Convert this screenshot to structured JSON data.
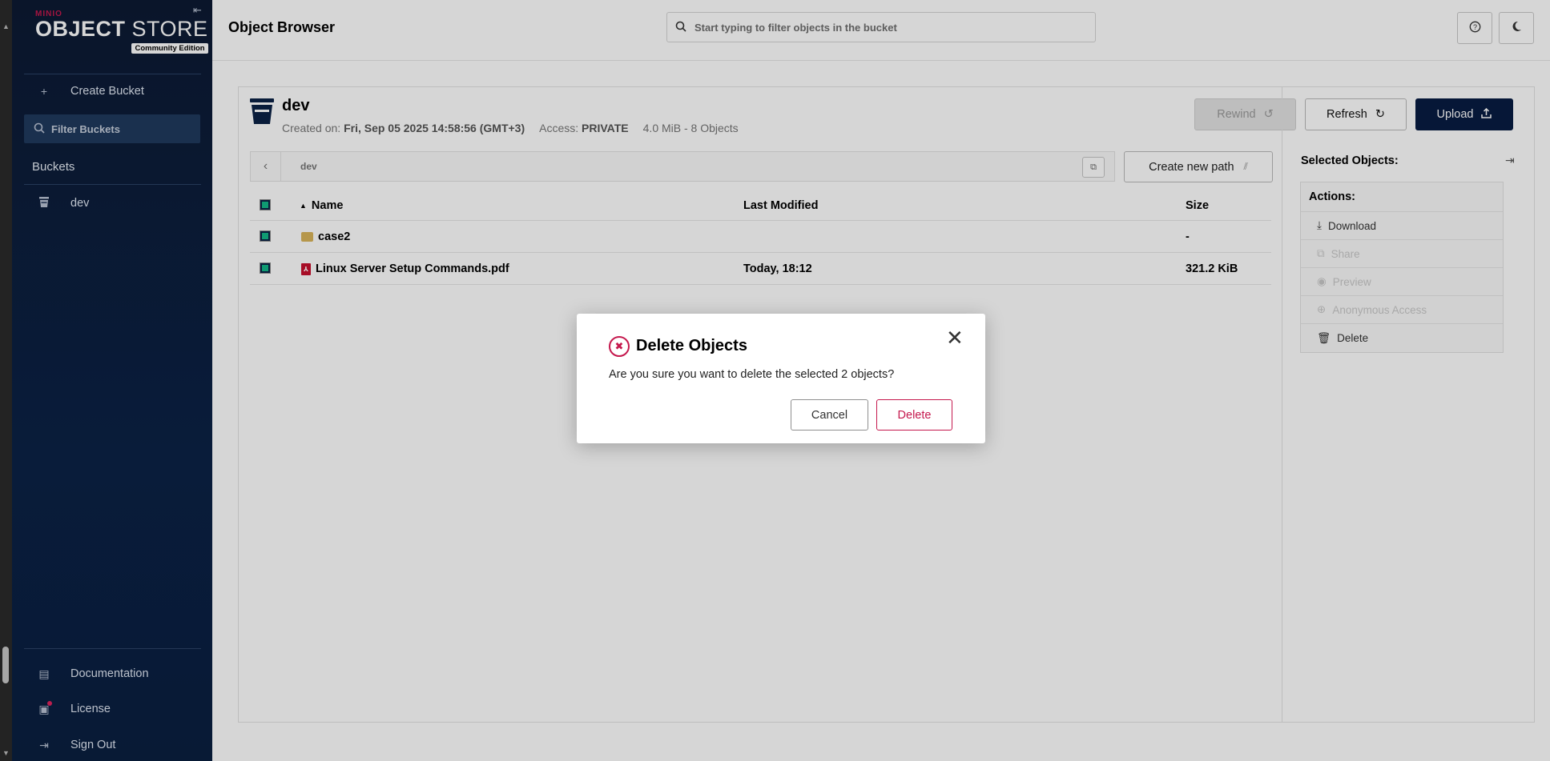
{
  "sidebar": {
    "brand": "MINIO",
    "product_prefix": "OBJECT",
    "product_suffix": " STORE",
    "edition": "Community Edition",
    "create_bucket": "Create Bucket",
    "filter_placeholder": "Filter Buckets",
    "buckets_heading": "Buckets",
    "buckets": [
      {
        "name": "dev"
      }
    ],
    "bottom_items": [
      {
        "label": "Documentation",
        "icon": "documentation-icon"
      },
      {
        "label": "License",
        "icon": "license-icon"
      },
      {
        "label": "Sign Out",
        "icon": "sign-out-icon"
      }
    ]
  },
  "header": {
    "title": "Object Browser",
    "search_placeholder": "Start typing to filter objects in the bucket"
  },
  "bucket": {
    "name": "dev",
    "created_label": "Created on: ",
    "created_value": "Fri, Sep 05 2025 14:58:56 (GMT+3)",
    "access_label": "Access: ",
    "access_value": "PRIVATE",
    "usage": "4.0 MiB - 8 Objects",
    "rewind_label": "Rewind",
    "refresh_label": "Refresh",
    "upload_label": "Upload"
  },
  "breadcrumb": {
    "path": "dev",
    "create_path_label": "Create new path"
  },
  "table": {
    "columns": [
      "Name",
      "Last Modified",
      "Size"
    ],
    "rows": [
      {
        "name": "case2",
        "type": "folder",
        "modified": "",
        "size": "-"
      },
      {
        "name": "Linux Server Setup Commands.pdf",
        "type": "pdf",
        "modified": "Today, 18:12",
        "size": "321.2 KiB"
      }
    ]
  },
  "side_panel": {
    "title": "Selected Objects:",
    "actions_heading": "Actions:",
    "actions": [
      {
        "label": "Download",
        "enabled": true
      },
      {
        "label": "Share",
        "enabled": false
      },
      {
        "label": "Preview",
        "enabled": false
      },
      {
        "label": "Anonymous Access",
        "enabled": false
      },
      {
        "label": "Delete",
        "enabled": true
      }
    ]
  },
  "modal": {
    "title": "Delete Objects",
    "message": "Are you sure you want to delete the selected 2 objects?",
    "cancel_label": "Cancel",
    "delete_label": "Delete"
  },
  "colors": {
    "sidebar_bg": "#0b2246",
    "accent": "#c5184d",
    "upload_bg": "#081c42",
    "checkbox": "#13b888"
  }
}
